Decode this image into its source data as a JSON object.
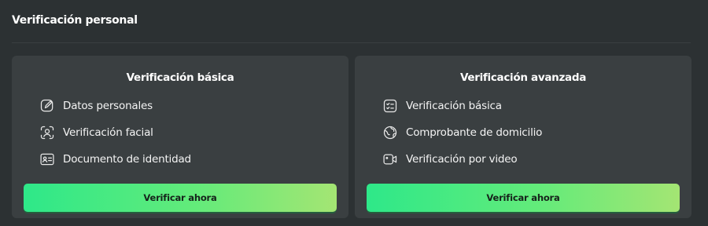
{
  "section": {
    "title": "Verificación personal"
  },
  "cards": [
    {
      "title": "Verificación básica",
      "items": [
        {
          "label": "Datos personales",
          "icon": "edit-icon"
        },
        {
          "label": "Verificación facial",
          "icon": "face-scan-icon"
        },
        {
          "label": "Documento de identidad",
          "icon": "id-card-icon"
        }
      ],
      "button_label": "Verificar ahora"
    },
    {
      "title": "Verificación avanzada",
      "items": [
        {
          "label": "Verificación básica",
          "icon": "checklist-icon"
        },
        {
          "label": "Comprobante de domicilio",
          "icon": "globe-icon"
        },
        {
          "label": "Verificación por video",
          "icon": "video-icon"
        }
      ],
      "button_label": "Verificar ahora"
    }
  ],
  "colors": {
    "background": "#2c3133",
    "card": "#3a3f41",
    "button_gradient_start": "#2ee889",
    "button_gradient_end": "#a4e573"
  }
}
